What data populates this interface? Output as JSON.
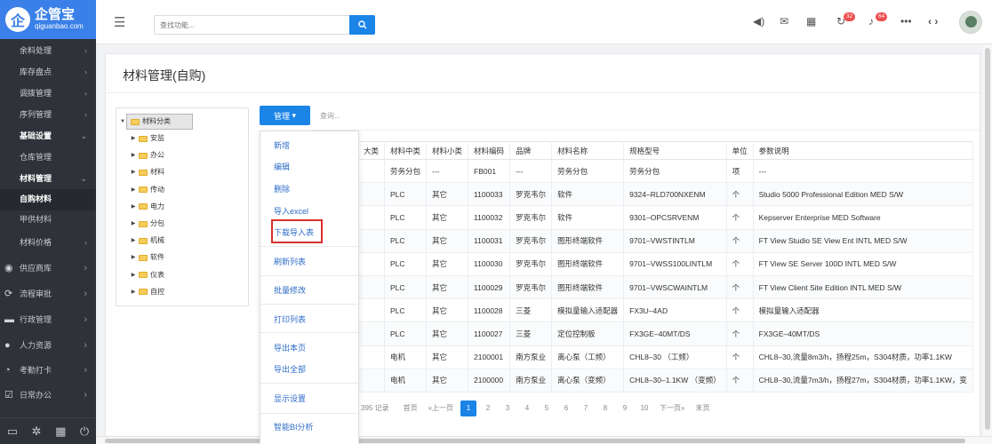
{
  "brand": {
    "logo_char": "企",
    "name": "企管宝",
    "domain": "qiguanbao.com"
  },
  "sidebar": {
    "items": [
      {
        "label": "余料处理",
        "style": "normal",
        "icon": ""
      },
      {
        "label": "库存盘点",
        "style": "normal",
        "icon": ""
      },
      {
        "label": "调拨管理",
        "style": "normal",
        "icon": ""
      },
      {
        "label": "序列管理",
        "style": "normal",
        "icon": ""
      },
      {
        "label": "基础设置",
        "style": "bold",
        "icon": ""
      },
      {
        "label": "仓库管理",
        "style": "sub",
        "icon": ""
      },
      {
        "label": "材料管理",
        "style": "bold",
        "icon": ""
      },
      {
        "label": "自购材料",
        "style": "act",
        "icon": ""
      },
      {
        "label": "甲供材料",
        "style": "sub",
        "icon": ""
      },
      {
        "label": "材料价格",
        "style": "normal",
        "icon": ""
      },
      {
        "label": "供应商库",
        "style": "ico",
        "icon": "supplier-icon"
      },
      {
        "label": "流程审批",
        "style": "ico",
        "icon": "approval-icon"
      },
      {
        "label": "行政管理",
        "style": "ico",
        "icon": "admin-icon"
      },
      {
        "label": "人力资源",
        "style": "ico",
        "icon": "hr-icon"
      },
      {
        "label": "考勤打卡",
        "style": "ico",
        "icon": "clock-icon"
      },
      {
        "label": "日常办公",
        "style": "ico",
        "icon": "office-icon"
      }
    ],
    "footer_icons": [
      "monitor-icon",
      "settings-icon",
      "lock-icon",
      "power-icon"
    ]
  },
  "topbar": {
    "search_placeholder": "查找功能...",
    "badges": {
      "refresh": "32",
      "bell": "64"
    }
  },
  "page": {
    "title": "材料管理(自购)"
  },
  "tree": {
    "root": "材料分类",
    "nodes": [
      "安监",
      "办公",
      "材料",
      "传动",
      "电力",
      "分包",
      "机械",
      "软件",
      "仪表",
      "自控"
    ]
  },
  "toolbar": {
    "manage_label": "管理",
    "query_placeholder": "查询..."
  },
  "dropdown": {
    "items": [
      "新增",
      "编辑",
      "删除",
      "导入excel",
      "下载导入表",
      "刷新列表",
      "批量修改",
      "打印列表",
      "导出本页",
      "导出全部",
      "显示设置",
      "智能BI分析"
    ]
  },
  "table": {
    "headers": [
      "大类",
      "材料中类",
      "材料小类",
      "材料编码",
      "品牌",
      "材料名称",
      "规格型号",
      "单位",
      "参数说明"
    ],
    "rows": [
      [
        "",
        "劳务分包",
        "---",
        "FB001",
        "---",
        "劳务分包",
        "劳务分包",
        "项",
        "---"
      ],
      [
        "",
        "PLC",
        "其它",
        "1100033",
        "罗克韦尔",
        "软件",
        "9324–RLD700NXENM",
        "个",
        "Studio 5000 Professional Edition MED S/W"
      ],
      [
        "",
        "PLC",
        "其它",
        "1100032",
        "罗克韦尔",
        "软件",
        "9301–OPCSRVENM",
        "个",
        "Kepserver Enterprise MED Software"
      ],
      [
        "",
        "PLC",
        "其它",
        "1100031",
        "罗克韦尔",
        "图形终端软件",
        "9701–VWSTINTLM",
        "个",
        "FT View Studio SE View Ent INTL MED S/W"
      ],
      [
        "",
        "PLC",
        "其它",
        "1100030",
        "罗克韦尔",
        "图形终端软件",
        "9701–VWSS100LINTLM",
        "个",
        "FT View SE Server 100D INTL MED S/W"
      ],
      [
        "",
        "PLC",
        "其它",
        "1100029",
        "罗克韦尔",
        "图形终端软件",
        "9701–VWSCWAINTLM",
        "个",
        "FT View Client Site Edition INTL MED S/W"
      ],
      [
        "",
        "PLC",
        "其它",
        "1100028",
        "三菱",
        "模拟量输入适配器",
        "FX3U–4AD",
        "个",
        "模拟量输入适配器"
      ],
      [
        "",
        "PLC",
        "其它",
        "1100027",
        "三菱",
        "定位控制板",
        "FX3GE–40MT/DS",
        "个",
        "FX3GE–40MT/DS"
      ],
      [
        "",
        "电机",
        "其它",
        "2100001",
        "南方泵业",
        "离心泵（工频）",
        "CHL8–30 （工频）",
        "个",
        "CHL8–30,流量8m3/h，扬程25m，S304材质，功率1.1KW"
      ],
      [
        "",
        "电机",
        "其它",
        "2100000",
        "南方泵业",
        "离心泵（变频）",
        "CHL8–30–1.1KW （变频）",
        "个",
        "CHL8–30,流量7m3/h，扬程27m，S304材质，功率1.1KW，变"
      ]
    ]
  },
  "pager": {
    "records": "395 记录",
    "first": "首页",
    "prev": "«上一页",
    "pages": [
      "1",
      "2",
      "3",
      "4",
      "5",
      "6",
      "7",
      "8",
      "9",
      "10"
    ],
    "current": "1",
    "next": "下一页»",
    "last": "末页"
  },
  "colors": {
    "accent": "#1b84e7",
    "sidebar_bg": "#2f3239",
    "logo_bg": "#3a80e8",
    "badge": "#ed4d4d",
    "highlight": "#d8302b",
    "folder": "#f5cd5a"
  }
}
